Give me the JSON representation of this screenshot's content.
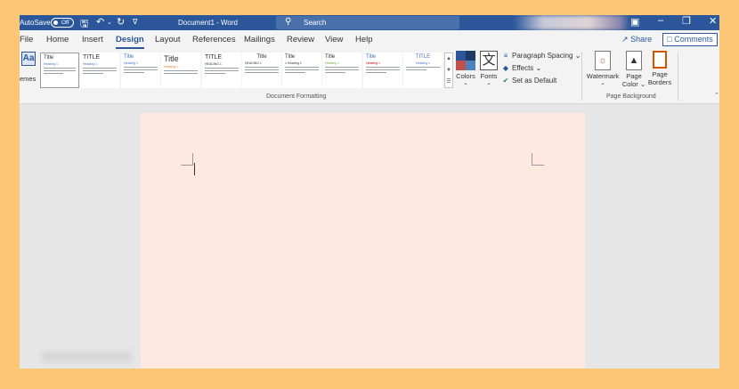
{
  "titlebar": {
    "autosave_label": "AutoSave",
    "autosave_state": "Off",
    "doc_title": "Document1  -  Word",
    "search_placeholder": "Search"
  },
  "tabs": [
    {
      "label": "File",
      "active": false
    },
    {
      "label": "Home",
      "active": false
    },
    {
      "label": "Insert",
      "active": false
    },
    {
      "label": "Design",
      "active": true
    },
    {
      "label": "Layout",
      "active": false
    },
    {
      "label": "References",
      "active": false
    },
    {
      "label": "Mailings",
      "active": false
    },
    {
      "label": "Review",
      "active": false
    },
    {
      "label": "View",
      "active": false
    },
    {
      "label": "Help",
      "active": false
    }
  ],
  "share_label": "Share",
  "comments_label": "Comments",
  "ribbon": {
    "themes_label": "emes",
    "style_sets": [
      {
        "title": "Title",
        "heading": "Heading 1"
      },
      {
        "title": "TITLE",
        "heading": "Heading 1"
      },
      {
        "title": "Title",
        "heading": "Heading 1"
      },
      {
        "title": "Title",
        "heading": "Heading 1"
      },
      {
        "title": "TITLE",
        "heading": "HEADING 1"
      },
      {
        "title": "Title",
        "heading": "HEADING 1"
      },
      {
        "title": "Title",
        "heading": "1  Heading 1"
      },
      {
        "title": "Title",
        "heading": "Heading 1"
      },
      {
        "title": "Title",
        "heading": "Heading 1"
      },
      {
        "title": "TITLE",
        "heading": "Heading 1"
      }
    ],
    "document_formatting_label": "Document Formatting",
    "colors_label": "Colors",
    "fonts_label": "Fonts",
    "paragraph_spacing_label": "Paragraph Spacing",
    "effects_label": "Effects",
    "set_default_label": "Set as Default",
    "watermark_label": "Watermark",
    "page_color_label_1": "Page",
    "page_color_label_2": "Color",
    "page_borders_label_1": "Page",
    "page_borders_label_2": "Borders",
    "page_background_label": "Page Background"
  },
  "colors": {
    "titlebar": "#2b579a",
    "page": "#fde9df",
    "outer_background": "#fbc776"
  }
}
